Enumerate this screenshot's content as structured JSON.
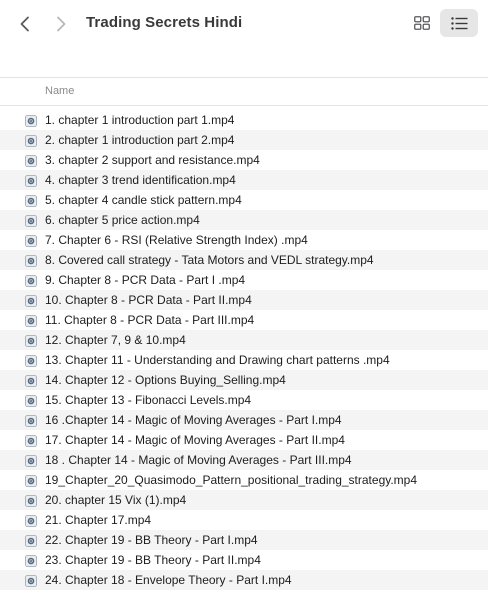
{
  "window": {
    "title": "Trading Secrets Hindi"
  },
  "icons": {
    "back": "chevron-left-icon",
    "forward": "chevron-right-icon",
    "grid_view": "grid-view-icon",
    "list_view": "list-view-icon",
    "file": "video-file-icon"
  },
  "colors": {
    "selected_view_bg": "#e6e6e6",
    "row_stripe": "#f4f4f5",
    "header_text": "#8a8a8e"
  },
  "columns": {
    "name": "Name"
  },
  "files": [
    "1. chapter 1 introduction part 1.mp4",
    "2. chapter 1 introduction part 2.mp4",
    "3. chapter 2 support and resistance.mp4",
    "4. chapter 3 trend identification.mp4",
    "5. chapter 4 candle stick pattern.mp4",
    "6. chapter 5 price action.mp4",
    "7. Chapter 6 - RSI (Relative Strength Index) .mp4",
    "8. Covered call strategy - Tata Motors and VEDL strategy.mp4",
    "9. Chapter 8 - PCR Data - Part I .mp4",
    "10. Chapter 8 - PCR Data - Part II.mp4",
    "11. Chapter 8 - PCR Data - Part III.mp4",
    "12. Chapter 7, 9 & 10.mp4",
    "13. Chapter 11 - Understanding and Drawing chart patterns .mp4",
    "14. Chapter 12 - Options Buying_Selling.mp4",
    "15. Chapter 13 - Fibonacci Levels.mp4",
    "16 .Chapter 14 - Magic of Moving Averages - Part I.mp4",
    "17. Chapter 14 - Magic of Moving Averages - Part II.mp4",
    "18 . Chapter 14 - Magic of Moving Averages - Part III.mp4",
    "19_Chapter_20_Quasimodo_Pattern_positional_trading_strategy.mp4",
    "20. chapter 15 Vix (1).mp4",
    "21. Chapter 17.mp4",
    "22. Chapter 19 - BB Theory - Part I.mp4",
    "23. Chapter 19 - BB Theory - Part II.mp4",
    "24. Chapter 18 - Envelope Theory - Part I.mp4"
  ]
}
